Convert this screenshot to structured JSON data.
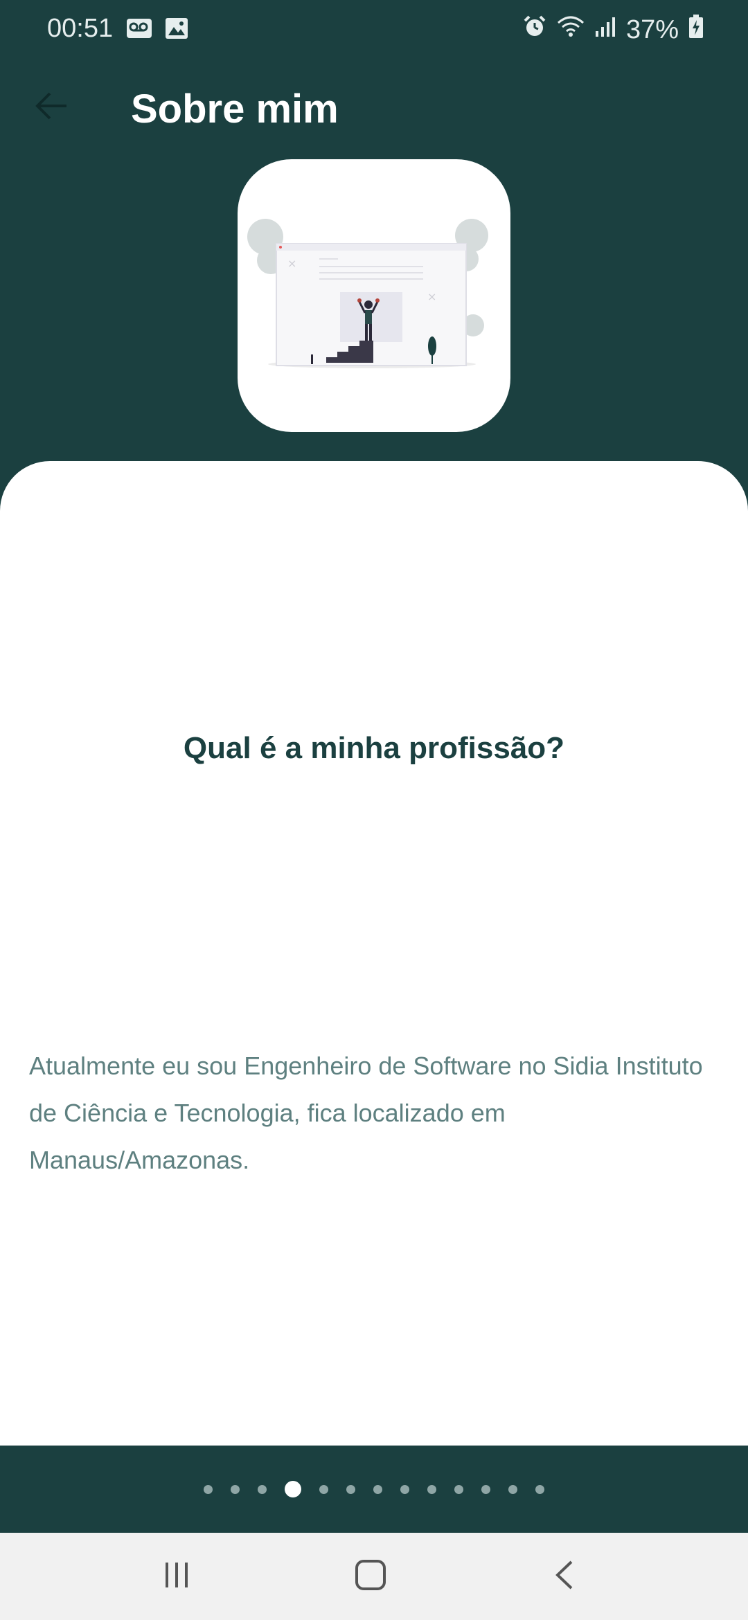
{
  "status_bar": {
    "time": "00:51",
    "battery": "37%",
    "left_icons": [
      "voicemail-icon",
      "image-icon"
    ],
    "right_icons": [
      "alarm-icon",
      "wifi-icon",
      "signal-icon",
      "battery-icon"
    ]
  },
  "app_bar": {
    "title": "Sobre mim",
    "back_icon": "arrow-left-icon"
  },
  "hero": {
    "illustration": "person-on-stairs-illustration"
  },
  "content": {
    "question": "Qual é a minha profissão?",
    "answer": "Atualmente eu sou Engenheiro de Software no Sidia Instituto de Ciência e Tecnologia, fica localizado em Manaus/Amazonas."
  },
  "pager": {
    "total": 13,
    "active_index": 3
  },
  "nav_bar": {
    "icons": [
      "recents-icon",
      "home-icon",
      "back-icon"
    ]
  },
  "colors": {
    "primary": "#1b4040",
    "answer_text": "#5e8080",
    "dot_inactive": "#8fa6a6"
  }
}
